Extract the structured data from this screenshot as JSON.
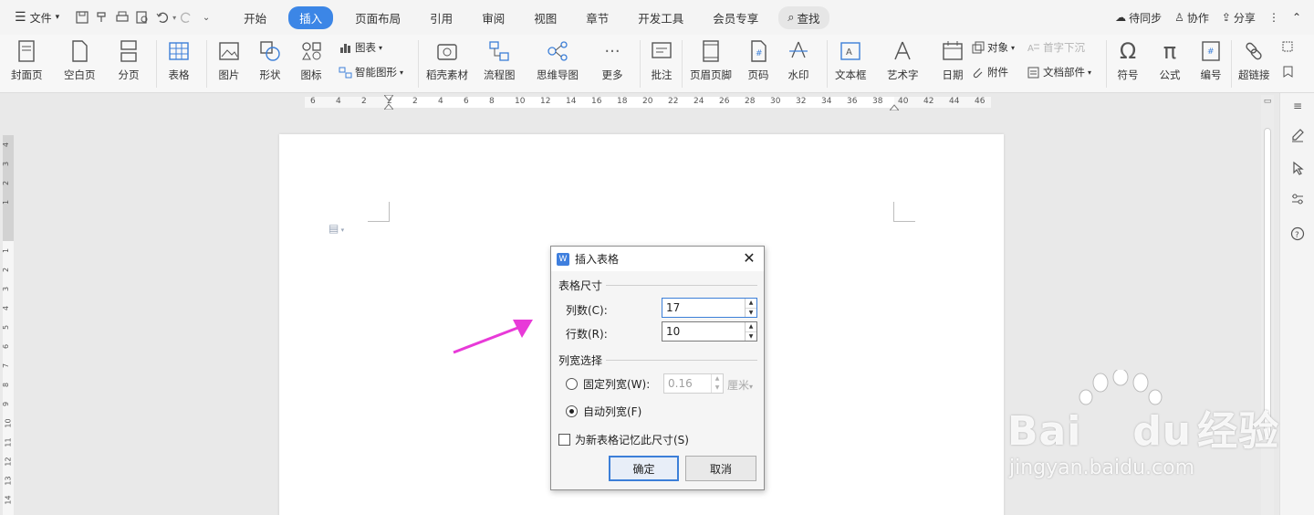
{
  "menubar": {
    "file_label": "文件",
    "tabs": [
      "开始",
      "插入",
      "页面布局",
      "引用",
      "审阅",
      "视图",
      "章节",
      "开发工具",
      "会员专享"
    ],
    "active_tab": "插入",
    "search_label": "查找",
    "sync_label": "待同步",
    "collab_label": "协作",
    "share_label": "分享"
  },
  "ribbon": {
    "cover": "封面页",
    "blank": "空白页",
    "pagebreak": "分页",
    "table": "表格",
    "picture": "图片",
    "shape": "形状",
    "icon": "图标",
    "chart": "图表",
    "smartart": "智能图形",
    "material": "稻壳素材",
    "flowchart": "流程图",
    "mindmap": "思维导图",
    "more": "更多",
    "comment": "批注",
    "header_footer": "页眉页脚",
    "page_number": "页码",
    "watermark": "水印",
    "textbox": "文本框",
    "wordart": "艺术字",
    "date": "日期",
    "object": "对象",
    "attachment": "附件",
    "dropcap": "首字下沉",
    "docparts": "文档部件",
    "symbol": "符号",
    "formula": "公式",
    "numbering": "编号",
    "hyperlink": "超链接"
  },
  "ruler": {
    "h_numbers": [
      "6",
      "4",
      "2",
      "2",
      "2",
      "4",
      "6",
      "8",
      "10",
      "12",
      "14",
      "16",
      "18",
      "20",
      "22",
      "24",
      "26",
      "28",
      "30",
      "32",
      "34",
      "36",
      "38",
      "40",
      "42",
      "44",
      "46"
    ],
    "v_numbers": [
      "4",
      "3",
      "2",
      "1",
      "1",
      "2",
      "3",
      "4",
      "5",
      "6",
      "7",
      "8",
      "9",
      "10",
      "11",
      "12",
      "13",
      "14",
      "15"
    ]
  },
  "dialog": {
    "title": "插入表格",
    "size_section": "表格尺寸",
    "cols_label": "列数(C):",
    "cols_value": "17",
    "rows_label": "行数(R):",
    "rows_value": "10",
    "width_section": "列宽选择",
    "fixed_label": "固定列宽(W):",
    "fixed_value": "0.16",
    "fixed_unit": "厘米",
    "auto_label": "自动列宽(F)",
    "remember_label": "为新表格记忆此尺寸(S)",
    "ok_label": "确定",
    "cancel_label": "取消"
  },
  "watermark": {
    "brand": "Bai",
    "brand_suffix": "经验",
    "url": "jingyan.baidu.com"
  },
  "colors": {
    "accent": "#3c86e6",
    "arrow": "#e83ad8"
  }
}
